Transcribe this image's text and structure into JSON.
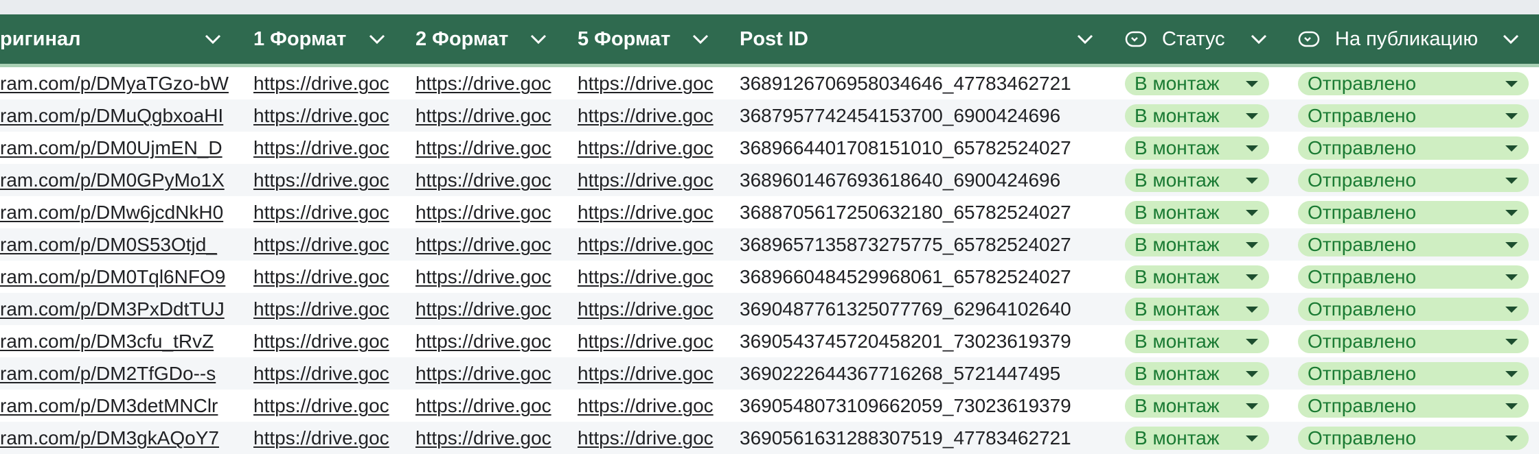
{
  "header": {
    "columns": [
      {
        "label": "ригинал"
      },
      {
        "label": "1 Формат"
      },
      {
        "label": "2 Формат"
      },
      {
        "label": "5 Формат"
      },
      {
        "label": "Post ID"
      },
      {
        "label": "Статус"
      },
      {
        "label": "На публикацию"
      }
    ]
  },
  "rows": [
    {
      "original": "ram.com/p/DMyaTGzo-bW",
      "f1": "https://drive.goc",
      "f2": "https://drive.goc",
      "f5": "https://drive.goc",
      "post_id": "3689126706958034646_47783462721",
      "status": "В монтаж",
      "publish": "Отправлено"
    },
    {
      "original": "ram.com/p/DMuQgbxoaHI",
      "f1": "https://drive.goc",
      "f2": "https://drive.goc",
      "f5": "https://drive.goc",
      "post_id": "3687957742454153700_6900424696",
      "status": "В монтаж",
      "publish": "Отправлено"
    },
    {
      "original": "ram.com/p/DM0UjmEN_D",
      "f1": "https://drive.goc",
      "f2": "https://drive.goc",
      "f5": "https://drive.goc",
      "post_id": "3689664401708151010_65782524027",
      "status": "В монтаж",
      "publish": "Отправлено"
    },
    {
      "original": "ram.com/p/DM0GPyMo1X",
      "f1": "https://drive.goc",
      "f2": "https://drive.goc",
      "f5": "https://drive.goc",
      "post_id": "3689601467693618640_6900424696",
      "status": "В монтаж",
      "publish": "Отправлено"
    },
    {
      "original": "ram.com/p/DMw6jcdNkH0",
      "f1": "https://drive.goc",
      "f2": "https://drive.goc",
      "f5": "https://drive.goc",
      "post_id": "3688705617250632180_65782524027",
      "status": "В монтаж",
      "publish": "Отправлено"
    },
    {
      "original": "ram.com/p/DM0S53Otjd_",
      "f1": "https://drive.goc",
      "f2": "https://drive.goc",
      "f5": "https://drive.goc",
      "post_id": "3689657135873275775_65782524027",
      "status": "В монтаж",
      "publish": "Отправлено"
    },
    {
      "original": "ram.com/p/DM0Tql6NFO9",
      "f1": "https://drive.goc",
      "f2": "https://drive.goc",
      "f5": "https://drive.goc",
      "post_id": "3689660484529968061_65782524027",
      "status": "В монтаж",
      "publish": "Отправлено"
    },
    {
      "original": "ram.com/p/DM3PxDdtTUJ",
      "f1": "https://drive.goc",
      "f2": "https://drive.goc",
      "f5": "https://drive.goc",
      "post_id": "3690487761325077769_62964102640",
      "status": "В монтаж",
      "publish": "Отправлено"
    },
    {
      "original": "ram.com/p/DM3cfu_tRvZ",
      "f1": "https://drive.goc",
      "f2": "https://drive.goc",
      "f5": "https://drive.goc",
      "post_id": "3690543745720458201_73023619379",
      "status": "В монтаж",
      "publish": "Отправлено"
    },
    {
      "original": "ram.com/p/DM2TfGDo--s",
      "f1": "https://drive.goc",
      "f2": "https://drive.goc",
      "f5": "https://drive.goc",
      "post_id": "3690222644367716268_5721447495",
      "status": "В монтаж",
      "publish": "Отправлено"
    },
    {
      "original": "ram.com/p/DM3detMNClr",
      "f1": "https://drive.goc",
      "f2": "https://drive.goc",
      "f5": "https://drive.goc",
      "post_id": "3690548073109662059_73023619379",
      "status": "В монтаж",
      "publish": "Отправлено"
    },
    {
      "original": "ram.com/p/DM3gkAQoY7",
      "f1": "https://drive.goc",
      "f2": "https://drive.goc",
      "f5": "https://drive.goc",
      "post_id": "3690561631288307519_47783462721",
      "status": "В монтаж",
      "publish": "Отправлено"
    }
  ],
  "colors": {
    "header_bg": "#2f6a4f",
    "chip_bg": "#cfeec2",
    "chip_text": "#1a7a33"
  },
  "icons": {
    "header_chevron": "chevron-down-icon",
    "column_type": "dropdown-column-icon",
    "chip_arrow": "dropdown-arrow-icon"
  }
}
